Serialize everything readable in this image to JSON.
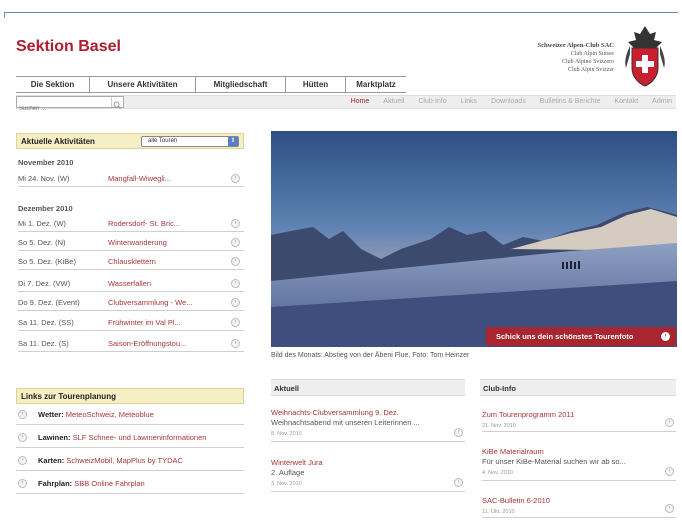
{
  "site": {
    "title": "Sektion Basel",
    "club": [
      "Schweizer Alpen-Club SAC",
      "Club Alpin Suisse",
      "Club Alpino Svizzero",
      "Club Alpin Svizzer"
    ]
  },
  "main_nav": [
    "Die Sektion",
    "Unsere Aktivitäten",
    "Mitgliedschaft",
    "Hütten",
    "Marktplatz"
  ],
  "search": {
    "placeholder": "Suchen ..."
  },
  "sub_nav": [
    "Home",
    "Aktuell",
    "Club-Info",
    "Links",
    "Downloads",
    "Bulletins & Berichte",
    "Kontakt",
    "Admin"
  ],
  "activities": {
    "title": "Aktuelle Aktivitäten",
    "filter": "alle Touren",
    "months": [
      {
        "name": "November 2010",
        "items": [
          {
            "date": "Mi 24. Nov. (W)",
            "title": "Mangfall-Wiwegli..."
          }
        ]
      },
      {
        "name": "Dezember 2010",
        "items": [
          {
            "date": "Mi 1. Dez. (W)",
            "title": "Rodersdorf- St. Bric..."
          },
          {
            "date": "So 5. Dez. (N)",
            "title": "Winterwanderung"
          },
          {
            "date": "So 5. Dez. (KiBe)",
            "title": "Chlausklettern"
          },
          {
            "date": "Di 7. Dez. (VW)",
            "title": "Wasserfallen"
          },
          {
            "date": "Do 9. Dez. (Event)",
            "title": "Clubversammlung - We..."
          },
          {
            "date": "Sa 11. Dez. (SS)",
            "title": "Frühwinter im Val Pl..."
          },
          {
            "date": "Sa 11. Dez. (S)",
            "title": "Saison-Eröffnungstou..."
          }
        ]
      }
    ]
  },
  "links": {
    "title": "Links zur Tourenplanung",
    "items": [
      {
        "label": "Wetter:",
        "value": "MeteoSchweiz, Meteoblue"
      },
      {
        "label": "Lawinen:",
        "value": "SLF Schnee- und Lawineninformationen"
      },
      {
        "label": "Karten:",
        "value": "SchweizMobil, MapPlus by TYDAC"
      },
      {
        "label": "Fahrplan:",
        "value": "SBB Online Fahrplan"
      }
    ]
  },
  "photo": {
    "button": "Schick uns dein schönstes Tourenfoto",
    "caption": "Bild des Monats: Abstieg von der Äbeni Flue, Foto: Tom Heinzer"
  },
  "aktuell": {
    "title": "Aktuell",
    "items": [
      {
        "title": "Weihnachts-Clubversammlung 9. Dez.",
        "summary": "Weihnachtsabend mit unseren Leiterinnen ...",
        "date": "8. Nov. 2010"
      },
      {
        "title": "Winterwelt Jura",
        "summary": "2. Auflage",
        "date": "3. Nov. 2010"
      }
    ]
  },
  "clubinfo": {
    "title": "Club-Info",
    "items": [
      {
        "title": "Zum Tourenprogramm 2011",
        "summary": "",
        "date": "21. Nov. 2010"
      },
      {
        "title": "KiBe Materialraum",
        "summary": "Für unser KiBe-Material suchen wir ab so...",
        "date": "4. Nov. 2010"
      },
      {
        "title": "SAC-Bulletin 6-2010",
        "summary": "",
        "date": "11. Okt. 2010"
      }
    ]
  },
  "colors": {
    "brand_red": "#b01c2e",
    "link_red": "#a8353a",
    "accent_blue": "#5b7fc2"
  }
}
